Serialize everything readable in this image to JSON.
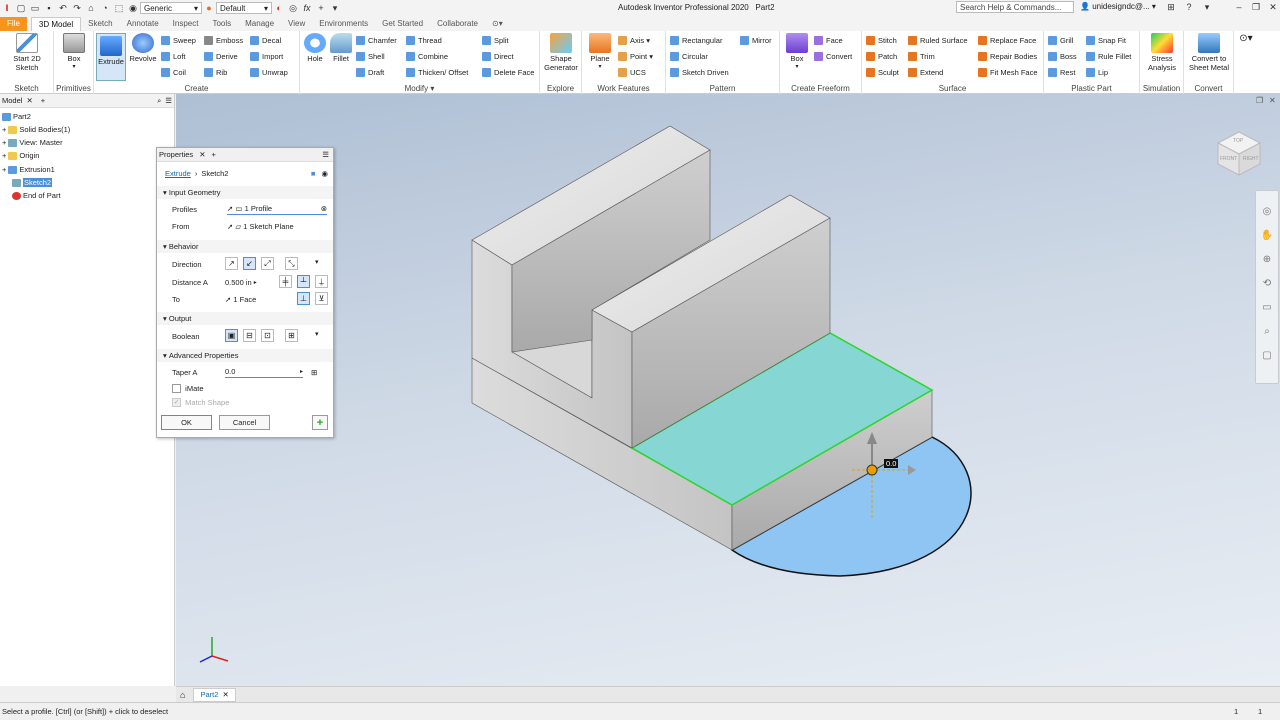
{
  "app": {
    "title": "Autodesk Inventor Professional 2020",
    "doc": "Part2"
  },
  "qat": {
    "material": "Generic",
    "appearance": "Default",
    "search": "Search Help & Commands...",
    "user": "unidesigndc@..."
  },
  "tabs": [
    "File",
    "3D Model",
    "Sketch",
    "Annotate",
    "Inspect",
    "Tools",
    "Manage",
    "View",
    "Environments",
    "Get Started",
    "Collaborate"
  ],
  "ribbon": {
    "sketch": {
      "label": "Sketch",
      "start": "Start 2D Sketch"
    },
    "primitives": {
      "label": "Primitives",
      "box": "Box"
    },
    "create": {
      "label": "Create",
      "extrude": "Extrude",
      "revolve": "Revolve",
      "sweep": "Sweep",
      "loft": "Loft",
      "coil": "Coil",
      "emboss": "Emboss",
      "derive": "Derive",
      "rib": "Rib",
      "decal": "Decal",
      "import": "Import",
      "unwrap": "Unwrap"
    },
    "modify": {
      "label": "Modify",
      "hole": "Hole",
      "fillet": "Fillet",
      "chamfer": "Chamfer",
      "shell": "Shell",
      "draft": "Draft",
      "thread": "Thread",
      "combine": "Combine",
      "thicken": "Thicken/ Offset",
      "split": "Split",
      "direct": "Direct",
      "deleteface": "Delete Face"
    },
    "explore": {
      "label": "Explore",
      "shape": "Shape Generator"
    },
    "work": {
      "label": "Work Features",
      "plane": "Plane",
      "axis": "Axis",
      "point": "Point",
      "ucs": "UCS"
    },
    "pattern": {
      "label": "Pattern",
      "rect": "Rectangular",
      "circ": "Circular",
      "sketchdriven": "Sketch Driven",
      "mirror": "Mirror"
    },
    "freeform": {
      "label": "Create Freeform",
      "box": "Box",
      "face": "Face",
      "convert": "Convert"
    },
    "surface": {
      "label": "Surface",
      "stitch": "Stitch",
      "patch": "Patch",
      "sculpt": "Sculpt",
      "ruled": "Ruled Surface",
      "trim": "Trim",
      "extend": "Extend",
      "replace": "Replace Face",
      "repair": "Repair Bodies",
      "fitmesh": "Fit Mesh Face"
    },
    "plastic": {
      "label": "Plastic Part",
      "grill": "Grill",
      "boss": "Boss",
      "rest": "Rest",
      "snapfit": "Snap Fit",
      "rulefillet": "Rule Fillet",
      "lip": "Lip"
    },
    "simulation": {
      "label": "Simulation",
      "stress": "Stress Analysis"
    },
    "convert": {
      "label": "Convert",
      "sheetmetal": "Convert to Sheet Metal"
    }
  },
  "browser": {
    "tab": "Model",
    "nodes": [
      "Part2",
      "Solid Bodies(1)",
      "View: Master",
      "Origin",
      "Extrusion1",
      "Sketch2",
      "End of Part"
    ]
  },
  "props": {
    "tab": "Properties",
    "breadcrumb_op": "Extrude",
    "breadcrumb_sketch": "Sketch2",
    "sec_input": "Input Geometry",
    "profiles_label": "Profiles",
    "profiles_value": "1 Profile",
    "from_label": "From",
    "from_value": "1 Sketch Plane",
    "sec_behavior": "Behavior",
    "direction_label": "Direction",
    "distance_label": "Distance A",
    "distance_value": "0.500 in",
    "to_label": "To",
    "to_value": "1 Face",
    "sec_output": "Output",
    "boolean_label": "Boolean",
    "sec_advanced": "Advanced Properties",
    "taper_label": "Taper A",
    "taper_value": "0.0",
    "imate": "iMate",
    "matchshape": "Match Shape",
    "ok": "OK",
    "cancel": "Cancel"
  },
  "viewport": {
    "value_box": "0.0",
    "viewcube_top": "TOP",
    "viewcube_front": "FRONT",
    "viewcube_right": "RIGHT"
  },
  "doctab": "Part2",
  "status": {
    "text": "Select a profile. [Ctrl] (or [Shift]) + click to deselect",
    "n1": "1",
    "n2": "1"
  },
  "colors": {
    "accent": "#f7941e",
    "profile": "#7ab8ec",
    "face": "#7fd4d4",
    "edge": "#2bd62b"
  }
}
